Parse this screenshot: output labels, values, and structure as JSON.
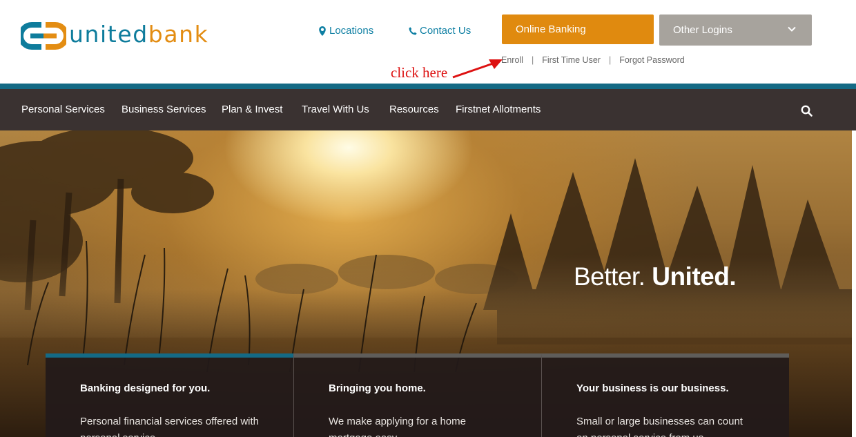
{
  "brand": {
    "united": "united",
    "bank": "bank",
    "colors": {
      "teal": "#0e7c9c",
      "orange": "#e38d13"
    }
  },
  "header": {
    "locations": "Locations",
    "contact": "Contact Us",
    "online_banking": "Online Banking",
    "other_logins": "Other Logins",
    "sublinks": {
      "enroll": "Enroll",
      "sep": "|",
      "first_time": "First Time User",
      "forgot": "Forgot Password"
    },
    "icons": {
      "locations": "map-pin-icon",
      "contact": "phone-icon",
      "other_logins": "chevron-down-icon"
    }
  },
  "annotation": {
    "text": "click here",
    "color": "#dd1111"
  },
  "nav": {
    "items": [
      "Personal Services",
      "Business Services",
      "Plan & Invest",
      "Travel With Us",
      "Resources",
      "Firstnet Allotments"
    ],
    "search_icon": "search-icon"
  },
  "hero": {
    "tagline_light": "Better.",
    "tagline_bold": "United."
  },
  "cards": [
    {
      "title": "Banking designed for you.",
      "body": "Personal financial services offered with personal service"
    },
    {
      "title": "Bringing you home.",
      "body": "We make applying for a home mortgage easy"
    },
    {
      "title": "Your business is our business.",
      "body": "Small or large businesses can count on personal service from us"
    }
  ]
}
